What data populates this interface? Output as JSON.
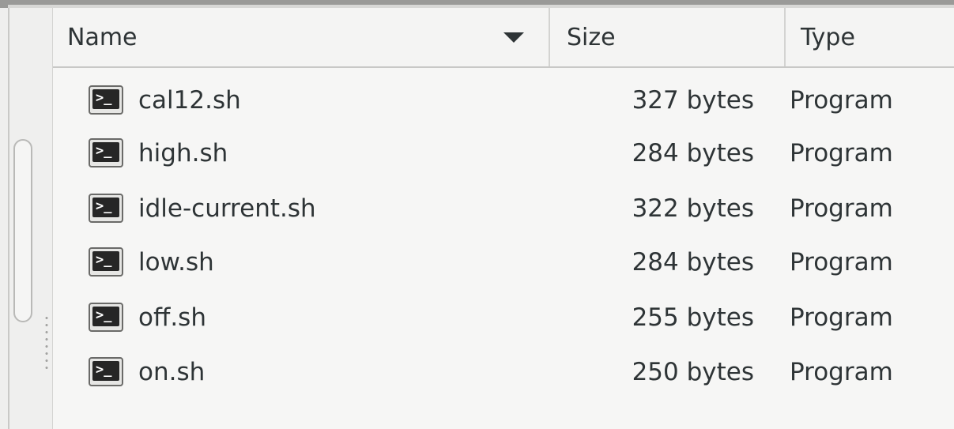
{
  "columns": {
    "name": "Name",
    "size": "Size",
    "type": "Type",
    "sort_indicator": "chevron-down-icon"
  },
  "files": [
    {
      "name": "cal12.sh",
      "size": "327 bytes",
      "type": "Program",
      "icon": "terminal-script-icon"
    },
    {
      "name": "high.sh",
      "size": "284 bytes",
      "type": "Program",
      "icon": "terminal-script-icon"
    },
    {
      "name": "idle-current.sh",
      "size": "322 bytes",
      "type": "Program",
      "icon": "terminal-script-icon"
    },
    {
      "name": "low.sh",
      "size": "284 bytes",
      "type": "Program",
      "icon": "terminal-script-icon"
    },
    {
      "name": "off.sh",
      "size": "255 bytes",
      "type": "Program",
      "icon": "terminal-script-icon"
    },
    {
      "name": "on.sh",
      "size": "250 bytes",
      "type": "Program",
      "icon": "terminal-script-icon"
    }
  ],
  "icon_glyph": ">_",
  "colors": {
    "text": "#2e3436",
    "background": "#f6f6f5",
    "header_background": "#f4f4f3",
    "terminal_screen": "#262626"
  }
}
